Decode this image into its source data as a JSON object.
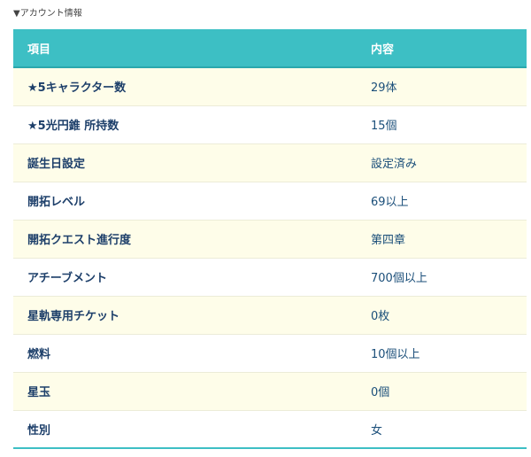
{
  "section_label": "▼アカウント情報",
  "table": {
    "headers": {
      "item": "項目",
      "content": "内容"
    },
    "rows": [
      {
        "item": "★5キャラクター数",
        "value": "29体"
      },
      {
        "item": "★5光円錐 所持数",
        "value": "15個"
      },
      {
        "item": "誕生日設定",
        "value": "設定済み"
      },
      {
        "item": "開拓レベル",
        "value": "69以上"
      },
      {
        "item": "開拓クエスト進行度",
        "value": "第四章"
      },
      {
        "item": "アチーブメント",
        "value": "700個以上"
      },
      {
        "item": "星軌専用チケット",
        "value": "0枚"
      },
      {
        "item": "燃料",
        "value": "10個以上"
      },
      {
        "item": "星玉",
        "value": "0個"
      },
      {
        "item": "性別",
        "value": "女"
      }
    ]
  },
  "colors": {
    "header_bg": "#3dbfc4",
    "odd_row_bg": "#fefde9",
    "even_row_bg": "#ffffff",
    "text": "#1b4f7a"
  }
}
